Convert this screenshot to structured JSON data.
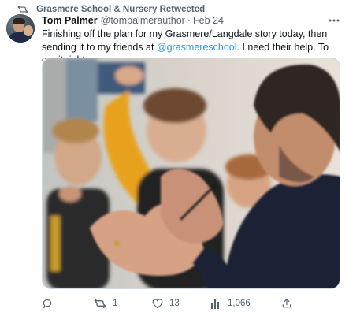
{
  "retweet": {
    "label": "Grasmere School & Nursery Retweeted",
    "icon": "retweet-icon"
  },
  "tweet": {
    "author_name": "Tom Palmer",
    "author_handle": "@tompalmerauthor",
    "separator": "·",
    "timestamp": "Feb 24",
    "text_before_mention": "Finishing off the plan for my Grasmere/Langdale story today, then sending it to my friends at ",
    "mention": "@grasmereschool",
    "text_after_mention": ". I need their help. To get it right.",
    "more_icon": "more-dots-icon",
    "media": {
      "kind": "photo",
      "description_visible": false
    }
  },
  "actions": {
    "reply": {
      "icon": "reply-icon",
      "count": ""
    },
    "retweet": {
      "icon": "retweet-icon",
      "count": "1"
    },
    "like": {
      "icon": "heart-icon",
      "count": "13"
    },
    "views": {
      "icon": "views-icon",
      "count": "1,066"
    },
    "share": {
      "icon": "share-icon",
      "count": ""
    }
  },
  "colors": {
    "text_primary": "#0f1419",
    "text_secondary": "#536471",
    "link": "#1d9bf0",
    "border": "#cfd9de"
  }
}
